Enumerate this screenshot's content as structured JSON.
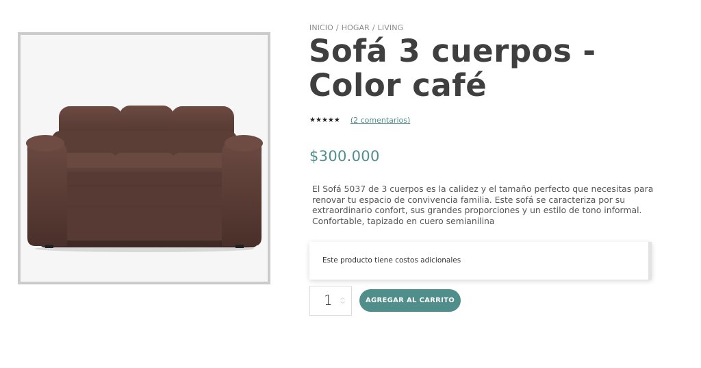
{
  "breadcrumb": {
    "items": [
      "INICIO",
      "HOGAR",
      "LIVING"
    ],
    "separator": "/"
  },
  "product": {
    "title": "Sofá 3 cuerpos - Color café",
    "rating": 5,
    "rating_max": 5,
    "reviews_label": "(2 comentarios)",
    "price": "$300.000",
    "description": "El Sofá 5037 de 3 cuerpos es la calidez y el tamaño perfecto que necesitas para renovar tu espacio de convivencia familia. Este sofá se caracteriza por su extraordinario confort, sus grandes proporciones y un estilo de tono informal. Confortable, tapizado en cuero semianilina",
    "notice": "Este producto tiene costos adicionales",
    "image_icon": "sofa-image"
  },
  "cart": {
    "quantity": "1",
    "add_button_label": "AGREGAR AL CARRITO"
  },
  "colors": {
    "accent": "#4f8e8a",
    "title": "#3f3f3f",
    "sofa": "#5a3d35"
  }
}
